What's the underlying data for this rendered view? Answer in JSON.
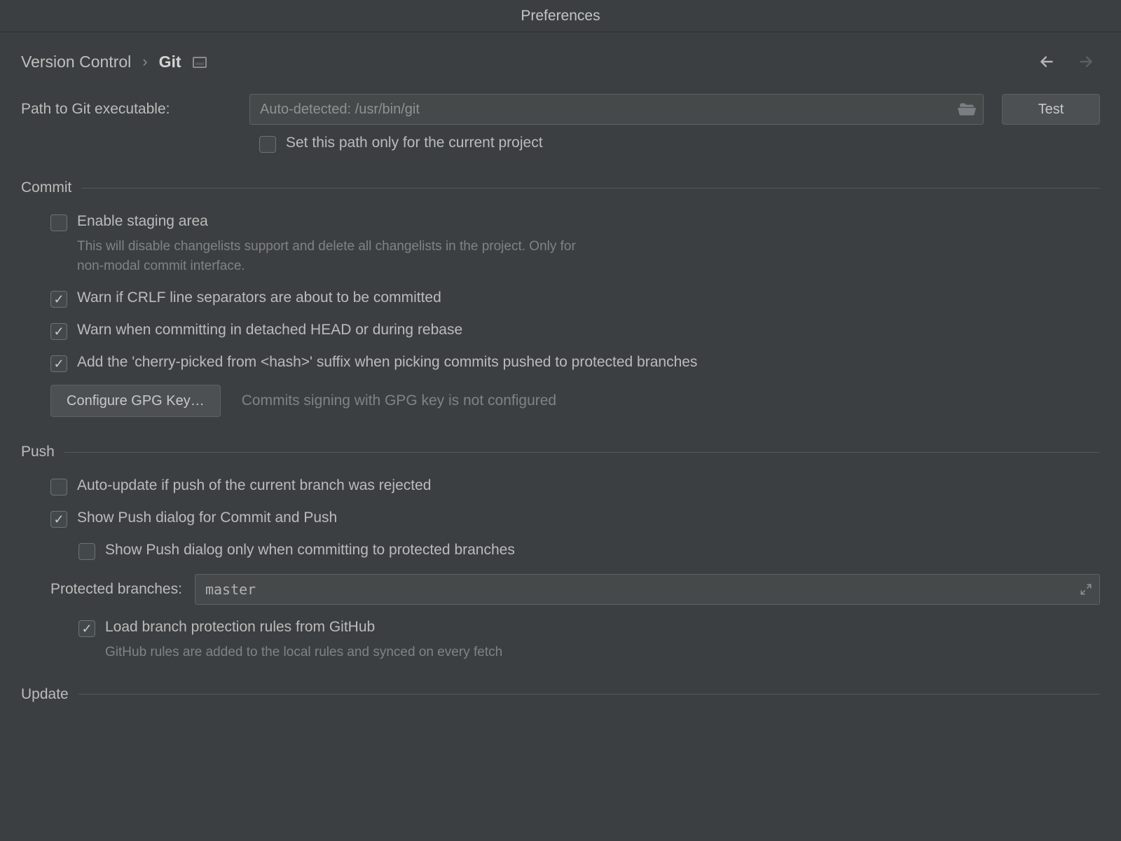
{
  "window": {
    "title": "Preferences"
  },
  "breadcrumb": {
    "parent": "Version Control",
    "sep": "›",
    "current": "Git"
  },
  "path": {
    "label": "Path to Git executable:",
    "placeholder": "Auto-detected: /usr/bin/git",
    "test_label": "Test",
    "only_current_project": "Set this path only for the current project"
  },
  "commit": {
    "title": "Commit",
    "enable_staging": "Enable staging area",
    "enable_staging_hint": "This will disable changelists support and delete all changelists in the project. Only for non-modal commit interface.",
    "warn_crlf": "Warn if CRLF line separators are about to be committed",
    "warn_detached": "Warn when committing in detached HEAD or during rebase",
    "cherry_pick_suffix": "Add the 'cherry-picked from <hash>' suffix when picking commits pushed to protected branches",
    "configure_gpg": "Configure GPG Key…",
    "gpg_status": "Commits signing with GPG key is not configured"
  },
  "push": {
    "title": "Push",
    "auto_update": "Auto-update if push of the current branch was rejected",
    "show_push_dialog": "Show Push dialog for Commit and Push",
    "show_push_protected": "Show Push dialog only when committing to protected branches",
    "protected_label": "Protected branches:",
    "protected_value": "master",
    "load_github": "Load branch protection rules from GitHub",
    "load_github_hint": "GitHub rules are added to the local rules and synced on every fetch"
  },
  "update": {
    "title": "Update"
  }
}
